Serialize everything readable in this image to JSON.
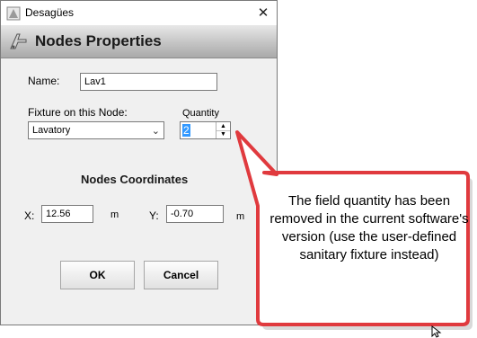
{
  "window": {
    "title": "Desagües"
  },
  "header": {
    "title": "Nodes Properties"
  },
  "form": {
    "name_label": "Name:",
    "name_value": "Lav1",
    "fixture_label": "Fixture on this Node:",
    "fixture_value": "Lavatory",
    "quantity_label": "Quantity",
    "quantity_value": "2"
  },
  "coordinates": {
    "title": "Nodes Coordinates",
    "x_label": "X:",
    "x_value": "12.56",
    "x_unit": "m",
    "y_label": "Y:",
    "y_value": "-0.70",
    "y_unit": "m"
  },
  "buttons": {
    "ok": "OK",
    "cancel": "Cancel"
  },
  "annotation": {
    "text": "The field quantity has been removed in the current software's version (use the user-defined sanitary fixture instead)",
    "border_color": "#e03a3e",
    "fill_color": "#ffffff"
  },
  "icons": [
    "app-icon",
    "close-icon",
    "fixture-icon",
    "chevron-down-icon",
    "spin-up-icon",
    "spin-down-icon",
    "mouse-cursor-icon"
  ]
}
